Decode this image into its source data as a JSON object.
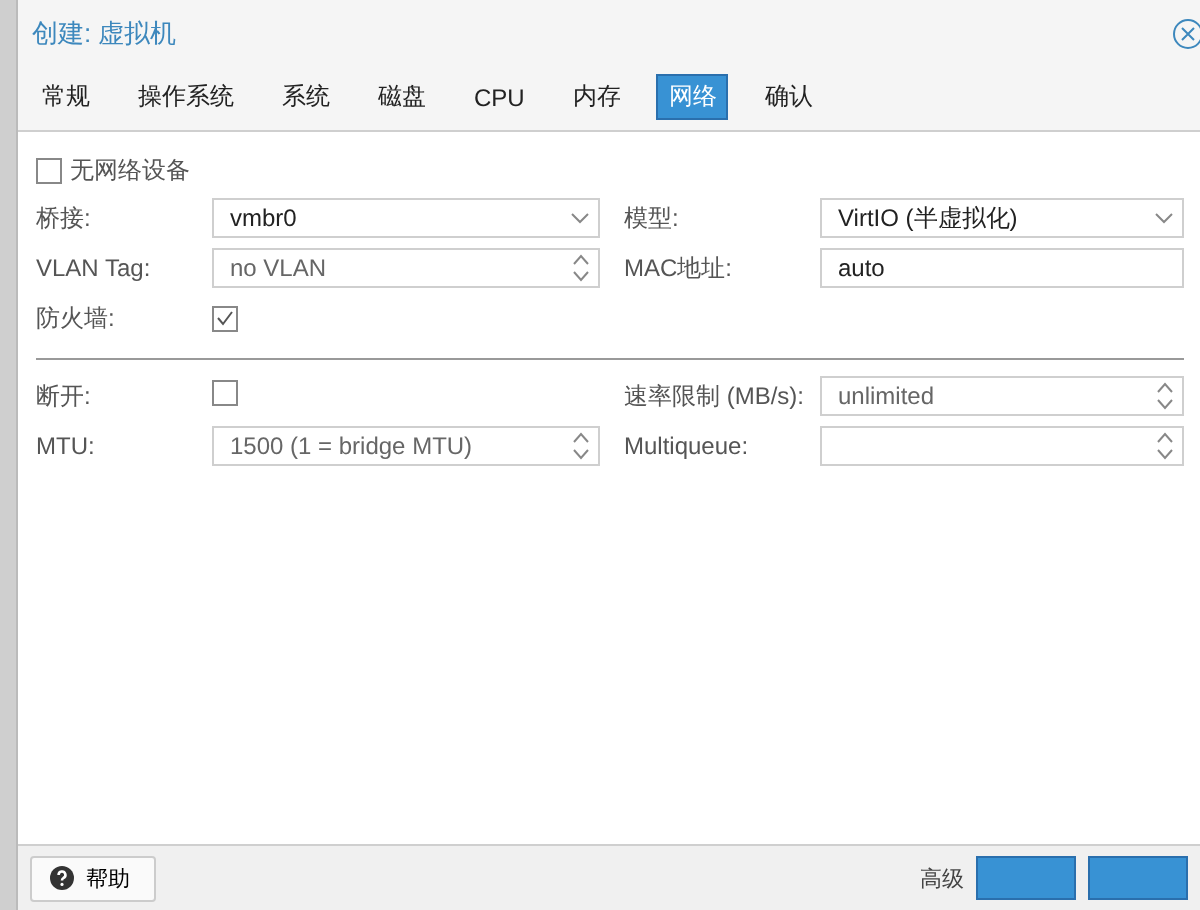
{
  "window": {
    "title": "创建: 虚拟机"
  },
  "tabs": [
    {
      "label": "常规",
      "selected": false
    },
    {
      "label": "操作系统",
      "selected": false
    },
    {
      "label": "系统",
      "selected": false
    },
    {
      "label": "磁盘",
      "selected": false
    },
    {
      "label": "CPU",
      "selected": false
    },
    {
      "label": "内存",
      "selected": false
    },
    {
      "label": "网络",
      "selected": true
    },
    {
      "label": "确认",
      "selected": false
    }
  ],
  "no_network_device": {
    "label": "无网络设备",
    "checked": false
  },
  "sections": [
    {
      "rows": [
        {
          "left": {
            "label": "桥接:",
            "kind": "combo",
            "value": "vmbr0"
          },
          "right": {
            "label": "模型:",
            "kind": "combo",
            "value": "VirtIO (半虚拟化)"
          }
        },
        {
          "left": {
            "label": "VLAN Tag:",
            "kind": "spinner",
            "placeholder": "no VLAN"
          },
          "right": {
            "label": "MAC地址:",
            "kind": "text",
            "value": "auto"
          }
        },
        {
          "left": {
            "label": "防火墙:",
            "kind": "checkbox",
            "checked": true
          }
        }
      ]
    },
    {
      "rows": [
        {
          "left": {
            "label": "断开:",
            "kind": "checkbox",
            "checked": false
          },
          "right": {
            "label": "速率限制 (MB/s):",
            "kind": "spinner",
            "placeholder": "unlimited"
          }
        },
        {
          "left": {
            "label": "MTU:",
            "kind": "spinner",
            "placeholder": "1500 (1 = bridge MTU)"
          },
          "right": {
            "label": "Multiqueue:",
            "kind": "spinner"
          }
        }
      ]
    }
  ],
  "footer": {
    "help": "帮助",
    "advanced": "高级"
  }
}
